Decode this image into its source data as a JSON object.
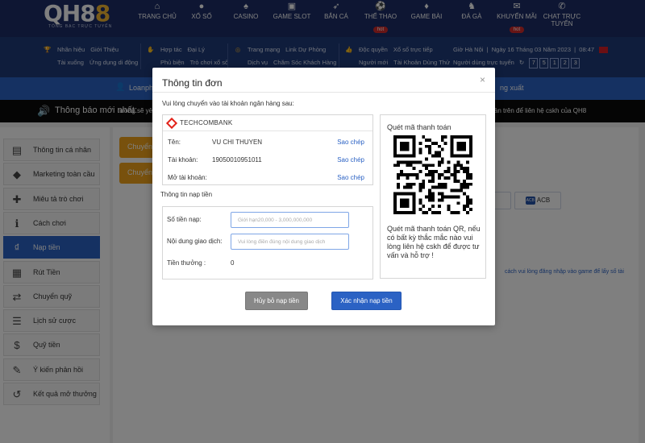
{
  "header": {
    "logo": {
      "text": "QH88",
      "tagline": "TỔNG BẠC TRỰC TUYẾN"
    },
    "nav": [
      {
        "label": "TRANG CHỦ",
        "icon": "home-icon",
        "glyph": "⌂"
      },
      {
        "label": "XỔ SỐ",
        "icon": "lottery-icon",
        "glyph": "●"
      },
      {
        "label": "CASINO",
        "icon": "casino-icon",
        "glyph": "♠"
      },
      {
        "label": "GAME SLOT",
        "icon": "slot-icon",
        "glyph": "▣"
      },
      {
        "label": "BẮN CÁ",
        "icon": "fish-icon",
        "glyph": "➶"
      },
      {
        "label": "THỂ THAO",
        "icon": "sports-icon",
        "glyph": "⚽",
        "badge": "hot"
      },
      {
        "label": "GAME BÀI",
        "icon": "cards-icon",
        "glyph": "♦"
      },
      {
        "label": "ĐÁ GÀ",
        "icon": "cockfight-icon",
        "glyph": "♞"
      },
      {
        "label": "KHUYẾN MÃI",
        "icon": "gift-icon",
        "glyph": "✉",
        "badge": "hot"
      },
      {
        "label": "CHAT TRỰC TUYẾN",
        "icon": "chat-icon",
        "glyph": "✆"
      }
    ]
  },
  "subbar": {
    "groups": [
      {
        "icon": "trophy-icon",
        "glyph": "🏆",
        "rows": [
          [
            "Nhãn hiệu",
            "Giới Thiệu"
          ],
          [
            "Tài xuống",
            "Ứng dụng di động"
          ]
        ]
      },
      {
        "icon": "handshake-icon",
        "glyph": "✋",
        "rows": [
          [
            "Hợp tác",
            "Đại Lý"
          ],
          [
            "Phủ biện",
            "Trò chơi xổ số"
          ]
        ]
      },
      {
        "icon": "globe-icon",
        "glyph": "◎",
        "rows": [
          [
            "Trang mạng",
            "Link Dự Phòng"
          ],
          [
            "Dịch vụ",
            "Chăm Sóc Khách Hàng"
          ]
        ]
      },
      {
        "icon": "thumb-icon",
        "glyph": "👍",
        "rows": [
          [
            "Độc quyền",
            "Xổ số trực tiếp"
          ],
          [
            "Người mới",
            "Tài Khoản Dùng Thử"
          ]
        ]
      }
    ],
    "clock": {
      "location": "Giờ Hà Nội",
      "date": "Ngày 16 Tháng 03 Năm 2023",
      "time": "08:47",
      "online_label": "Người dùng trực tuyến",
      "digits": [
        "7",
        "5",
        "1",
        "2",
        "3"
      ]
    }
  },
  "userbar": {
    "username": "Loanph",
    "logout": "ng xuất"
  },
  "ticker": {
    "label": "Thông báo mới nhất:",
    "message": "tương sẽ yêu",
    "message_end": "khoản trên để liên hệ cskh của QH8"
  },
  "sidebar": {
    "items": [
      {
        "label": "Thông tin cá nhân",
        "icon": "id-card-icon",
        "glyph": "▤"
      },
      {
        "label": "Marketing toàn cầu",
        "icon": "diamond-icon",
        "glyph": "◆"
      },
      {
        "label": "Miêu tả trò chơi",
        "icon": "gamepad-icon",
        "glyph": "✚"
      },
      {
        "label": "Cách chơi",
        "icon": "info-icon",
        "glyph": "ℹ"
      },
      {
        "label": "Nạp tiền",
        "icon": "piggy-bank-icon",
        "glyph": "₫",
        "active": true
      },
      {
        "label": "Rút Tiền",
        "icon": "withdraw-icon",
        "glyph": "▦"
      },
      {
        "label": "Chuyển quỹ",
        "icon": "transfer-icon",
        "glyph": "⇄"
      },
      {
        "label": "Lịch sử cược",
        "icon": "history-icon",
        "glyph": "☰"
      },
      {
        "label": "Quỹ tiền",
        "icon": "coins-icon",
        "glyph": "$"
      },
      {
        "label": "Ý kiến phản hồi",
        "icon": "feedback-icon",
        "glyph": "✎"
      },
      {
        "label": "Kết quả mở thưởng",
        "icon": "results-icon",
        "glyph": "↺"
      }
    ]
  },
  "main": {
    "tabs": [
      "Chuyển",
      "Chuyển"
    ],
    "banks": [
      {
        "label": "K"
      },
      {
        "label": "ACB",
        "logo": "ACB"
      }
    ],
    "note": "cách vui lòng đăng nhập vào game để lấy số tài"
  },
  "modal": {
    "title": "Thông tin đơn",
    "close": "×",
    "instruction": "Vui lòng chuyển vào tài khoản ngân hàng sau:",
    "bank": {
      "name": "TECHCOMBANK",
      "rows": [
        {
          "label": "Tên:",
          "value": "VU CHI THUYEN",
          "copy": "Sao chép"
        },
        {
          "label": "Tài khoản:",
          "value": "19050010951011",
          "copy": "Sao chép"
        },
        {
          "label": "Mở tài khoản:",
          "value": "",
          "copy": "Sao chép"
        }
      ]
    },
    "deposit_section": "Thông tin nạp tiền",
    "form": {
      "amount": {
        "label": "Số tiền nạp:",
        "placeholder": "Giới hạn20,000 - 3,000,000,000"
      },
      "content": {
        "label": "Nội dung giao dịch:",
        "placeholder": "Vui lòng điền đúng nội dung giao dịch"
      },
      "bonus": {
        "label": "Tiền thưởng :",
        "value": "0"
      }
    },
    "qr": {
      "title": "Quét mã thanh toán",
      "help": "Quét mã thanh toán QR, nếu có bất kỳ thắc mắc nào vui lòng liên hệ cskh để được tư vấn và hỗ trợ !"
    },
    "buttons": {
      "cancel": "Hủy bỏ nạp tiền",
      "confirm": "Xác nhận nạp tiền"
    }
  },
  "colors": {
    "nav_bg": "#1c2d66",
    "accent_blue": "#2b62c4",
    "orange": "#f0a31b",
    "hot_red": "#d12b2b"
  }
}
